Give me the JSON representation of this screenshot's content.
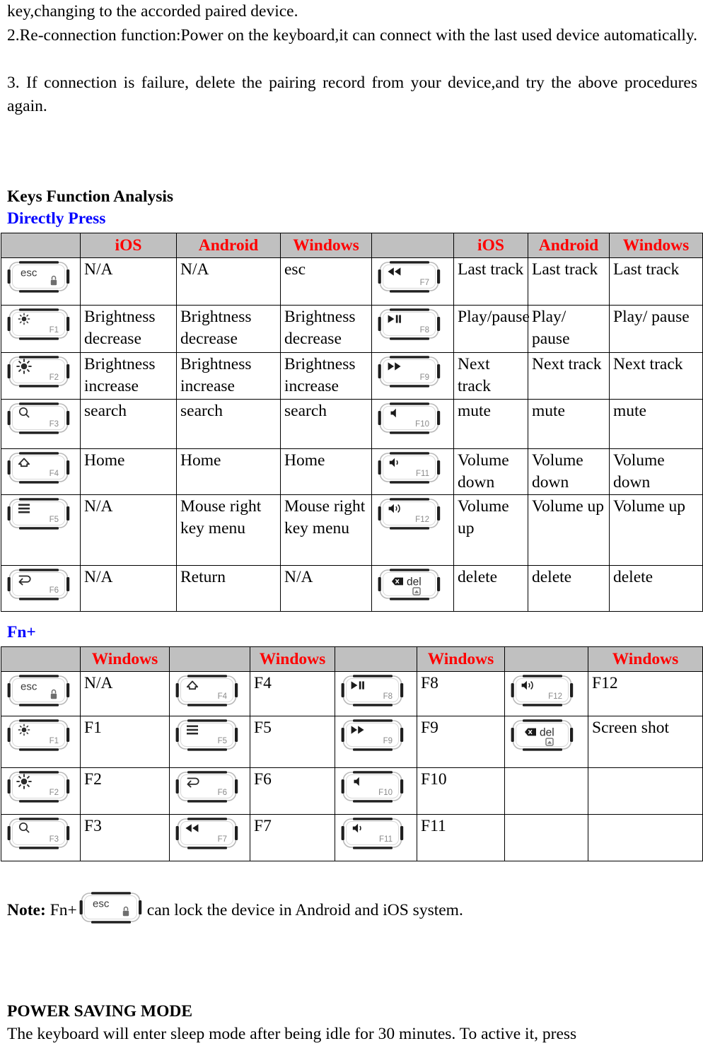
{
  "intro": {
    "line1": "key,changing to the accorded paired device.",
    "line2": "2.Re-connection function:Power on the keyboard,it can connect with the last used device automatically.",
    "line3": "3. If connection is failure, delete the pairing record from your device,and try the above procedures again."
  },
  "headings": {
    "keys_function_analysis": "Keys Function Analysis",
    "directly_press": "Directly Press",
    "fn_plus": "Fn+"
  },
  "directly_press_table": {
    "headers": [
      "",
      "iOS",
      "Android",
      "Windows",
      "",
      "iOS",
      "Android",
      "Windows"
    ],
    "rows": [
      {
        "left_key": "esc-key",
        "left_key_label": "esc",
        "left_key_fn": "",
        "ios": "N/A",
        "android": "N/A",
        "windows": "esc",
        "right_key": "rewind-key",
        "right_key_fn": "F7",
        "ios2": "Last track",
        "android2": "Last track",
        "windows2": "Last track"
      },
      {
        "left_key": "brightness-decrease-key",
        "left_key_fn": "F1",
        "ios": "Brightness decrease",
        "android": "Brightness decrease",
        "windows": "Brightness decrease",
        "right_key": "play-pause-key",
        "right_key_fn": "F8",
        "ios2": "Play/pause",
        "android2": "Play/ pause",
        "windows2": "Play/ pause"
      },
      {
        "left_key": "brightness-increase-key",
        "left_key_fn": "F2",
        "ios": "Brightness increase",
        "android": "Brightness increase",
        "windows": "Brightness increase",
        "right_key": "forward-key",
        "right_key_fn": "F9",
        "ios2": "Next track",
        "android2": "Next track",
        "windows2": "Next track"
      },
      {
        "left_key": "search-key",
        "left_key_fn": "F3",
        "ios": "search",
        "android": "search",
        "windows": "search",
        "right_key": "mute-key",
        "right_key_fn": "F10",
        "ios2": "mute",
        "android2": "mute",
        "windows2": "mute"
      },
      {
        "left_key": "home-key",
        "left_key_fn": "F4",
        "ios": "Home",
        "android": "Home",
        "windows": "Home",
        "right_key": "volume-down-key",
        "right_key_fn": "F11",
        "ios2": "Volume down",
        "android2": "Volume down",
        "windows2": "Volume down"
      },
      {
        "left_key": "menu-key",
        "left_key_fn": "F5",
        "ios": "N/A",
        "android": "Mouse right key menu",
        "windows": "Mouse right key menu",
        "right_key": "volume-up-key",
        "right_key_fn": "F12",
        "ios2": "Volume up",
        "android2": "Volume up",
        "windows2": "Volume up"
      },
      {
        "left_key": "return-key",
        "left_key_fn": "F6",
        "ios": "N/A",
        "android": "Return",
        "windows": "N/A",
        "right_key": "delete-key",
        "right_key_label": "del",
        "right_key_fn": "",
        "ios2": "delete",
        "android2": "delete",
        "windows2": "delete"
      }
    ]
  },
  "fn_table": {
    "headers": [
      "",
      "Windows",
      "",
      "Windows",
      "",
      "Windows",
      "",
      "Windows"
    ],
    "rows": [
      {
        "k1": "esc-key",
        "k1_label": "esc",
        "k1_fn": "",
        "v1": "N/A",
        "k2": "home-key",
        "k2_fn": "F4",
        "v2": "F4",
        "k3": "play-pause-key",
        "k3_fn": "F8",
        "v3": "F8",
        "k4": "volume-up-key",
        "k4_fn": "F12",
        "v4": "F12"
      },
      {
        "k1": "brightness-decrease-key",
        "k1_fn": "F1",
        "v1": "F1",
        "k2": "menu-key",
        "k2_fn": "F5",
        "v2": "F5",
        "k3": "forward-key",
        "k3_fn": "F9",
        "v3": "F9",
        "k4": "delete-key",
        "k4_label": "del",
        "k4_fn": "",
        "v4": "Screen shot"
      },
      {
        "k1": "brightness-increase-key",
        "k1_fn": "F2",
        "v1": "F2",
        "k2": "return-key",
        "k2_fn": "F6",
        "v2": "F6",
        "k3": "mute-key",
        "k3_fn": "F10",
        "v3": "F10",
        "k4": "",
        "k4_fn": "",
        "v4": ""
      },
      {
        "k1": "search-key",
        "k1_fn": "F3",
        "v1": "F3",
        "k2": "rewind-key",
        "k2_fn": "F7",
        "v2": "F7",
        "k3": "volume-down-key",
        "k3_fn": "F11",
        "v3": "F11",
        "k4": "",
        "k4_fn": "",
        "v4": ""
      }
    ]
  },
  "note": {
    "prefix": "Note:",
    "fn_text": "Fn+",
    "key": "esc-key",
    "key_label": "esc",
    "suffix": "can lock the device in Android and iOS system."
  },
  "power_saving": {
    "title": "POWER SAVING MODE",
    "text": "The keyboard will enter sleep mode after being idle for 30 minutes. To active it, press"
  },
  "colors": {
    "header_bg": "#c0c0c0",
    "header_text": "#ff0000",
    "heading_blue": "#0000ff",
    "body_text": "#000000"
  }
}
